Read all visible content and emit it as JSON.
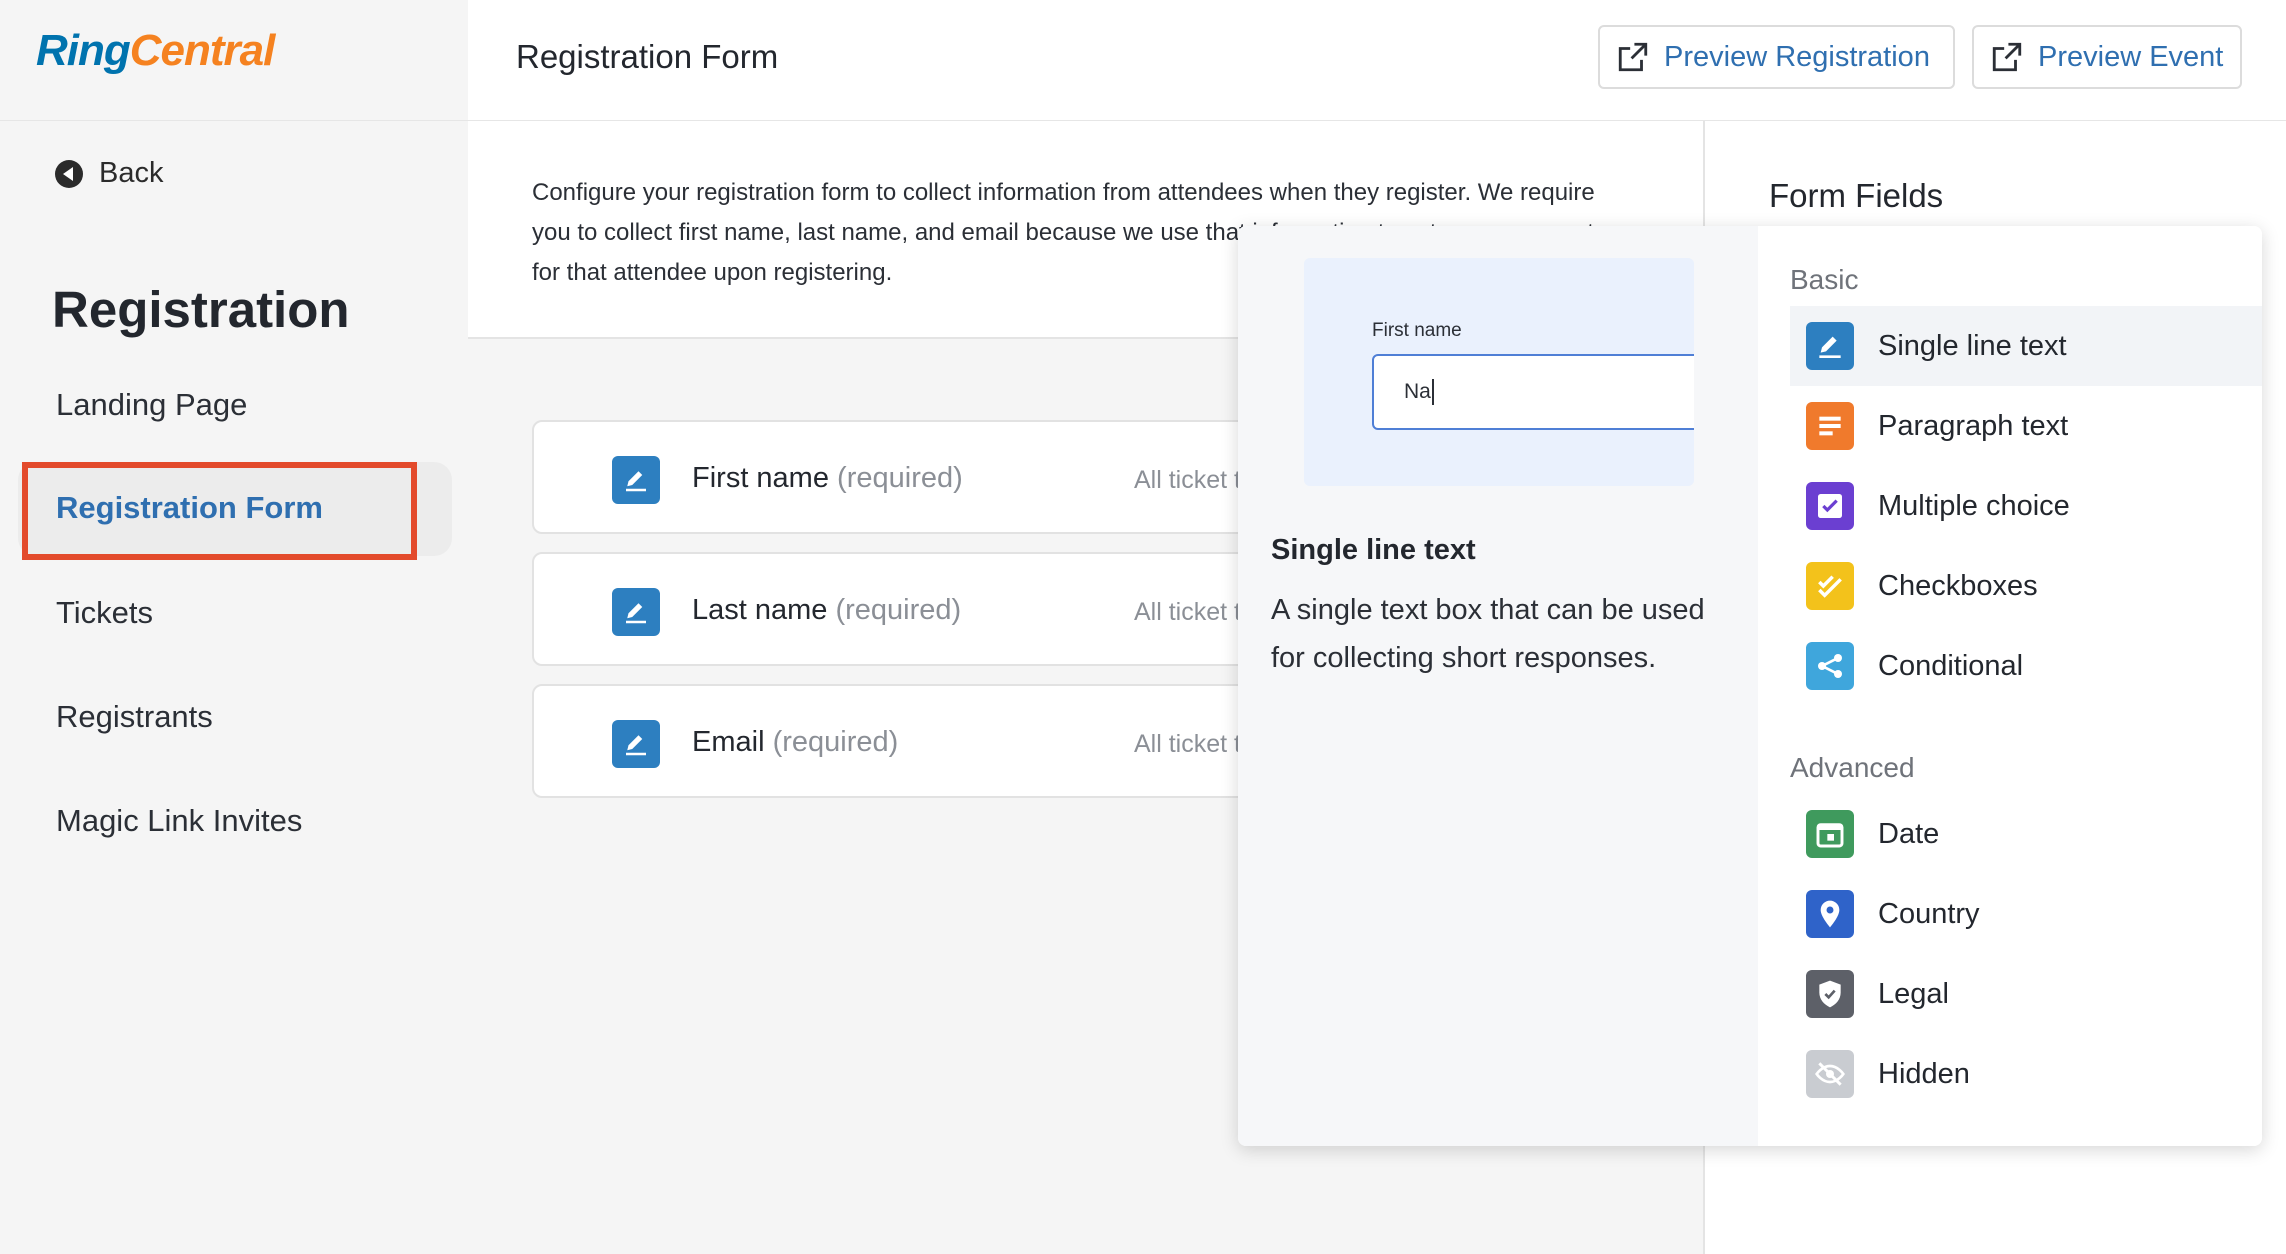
{
  "brand": {
    "logo_part1": "Ring",
    "logo_part2": "Central"
  },
  "sidebar": {
    "back_label": "Back",
    "section_title": "Registration",
    "items": [
      {
        "label": "Landing Page"
      },
      {
        "label": "Registration Form"
      },
      {
        "label": "Tickets"
      },
      {
        "label": "Registrants"
      },
      {
        "label": "Magic Link Invites"
      }
    ]
  },
  "header": {
    "title": "Registration Form",
    "preview_registration": "Preview Registration",
    "preview_event": "Preview Event"
  },
  "main": {
    "intro": "Configure your registration form to collect information from attendees when they register. We require you to collect first name, last name, and email because we use that information to set up an account for that attendee upon registering.",
    "fields": [
      {
        "label": "First name",
        "required": "(required)",
        "tickets": "All ticket t"
      },
      {
        "label": "Last name",
        "required": "(required)",
        "tickets": "All ticket t"
      },
      {
        "label": "Email",
        "required": "(required)",
        "tickets": "All ticket t"
      }
    ]
  },
  "right_panel": {
    "title": "Form Fields"
  },
  "popover": {
    "preview_field_label": "First name",
    "preview_input_value": "Na",
    "title": "Single line text",
    "description": "A single text box that can be used for collecting short responses.",
    "basic_title": "Basic",
    "advanced_title": "Advanced",
    "basic": [
      {
        "label": "Single line text",
        "icon": "edit-icon",
        "color": "#2d7fc0"
      },
      {
        "label": "Paragraph text",
        "icon": "paragraph-icon",
        "color": "#f07a2c"
      },
      {
        "label": "Multiple choice",
        "icon": "checkbox-icon",
        "color": "#6b3fd1"
      },
      {
        "label": "Checkboxes",
        "icon": "double-check-icon",
        "color": "#f3c21b"
      },
      {
        "label": "Conditional",
        "icon": "branch-icon",
        "color": "#3fa6dc"
      }
    ],
    "advanced": [
      {
        "label": "Date",
        "icon": "calendar-icon",
        "color": "#3f9a5d"
      },
      {
        "label": "Country",
        "icon": "location-pin-icon",
        "color": "#2f63c9"
      },
      {
        "label": "Legal",
        "icon": "shield-check-icon",
        "color": "#5d6068"
      },
      {
        "label": "Hidden",
        "icon": "eye-off-icon",
        "color": "#c9ccd1"
      }
    ]
  }
}
